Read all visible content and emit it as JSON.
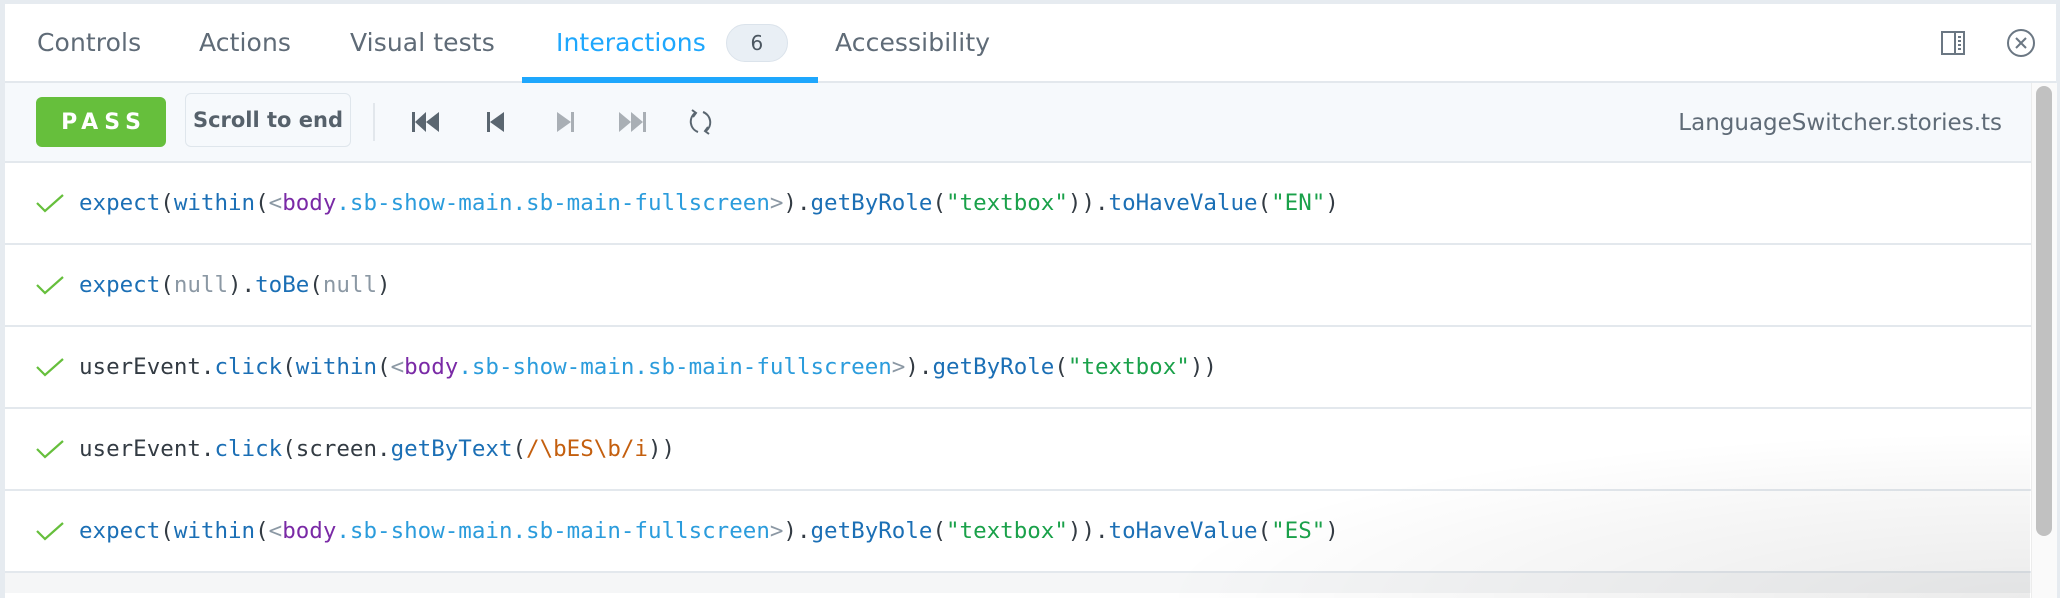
{
  "tabs": [
    {
      "label": "Controls",
      "active": false
    },
    {
      "label": "Actions",
      "active": false
    },
    {
      "label": "Visual tests",
      "active": false
    },
    {
      "label": "Interactions",
      "active": true,
      "badge": "6"
    },
    {
      "label": "Accessibility",
      "active": false
    }
  ],
  "tab_actions": {
    "toggle_panel_icon": "sidebar-right-icon",
    "close_icon": "close-circle-icon"
  },
  "toolbar": {
    "status_label": "PASS",
    "scroll_to_end_label": "Scroll to end",
    "nav": [
      "jump-to-start-icon",
      "step-back-icon",
      "step-forward-icon",
      "jump-to-end-icon",
      "rerun-icon"
    ],
    "story_file": "LanguageSwitcher.stories.ts"
  },
  "colors": {
    "accent": "#1ea7fd",
    "pass": "#66bf3c",
    "check": "#66bf3c",
    "function": "#1b6fb5",
    "string": "#1aa14a",
    "element_tag": "#7a2aa6",
    "element_class": "#2b9cdc",
    "regex": "#c45f0e",
    "null": "#8b98a4"
  },
  "interactions": [
    {
      "status": "pass",
      "tokens": [
        {
          "t": "expect",
          "k": "fn"
        },
        {
          "t": "(",
          "k": "punct"
        },
        {
          "t": "within",
          "k": "fn"
        },
        {
          "t": "(",
          "k": "punct"
        },
        {
          "t": "<",
          "k": "el-bracket"
        },
        {
          "t": "body",
          "k": "el-tag"
        },
        {
          "t": ".sb-show-main.sb-main-fullscreen",
          "k": "el-cls"
        },
        {
          "t": ">",
          "k": "el-bracket"
        },
        {
          "t": ").",
          "k": "punct"
        },
        {
          "t": "getByRole",
          "k": "fn"
        },
        {
          "t": "(",
          "k": "punct"
        },
        {
          "t": "\"textbox\"",
          "k": "str"
        },
        {
          "t": ")).",
          "k": "punct"
        },
        {
          "t": "toHaveValue",
          "k": "fn"
        },
        {
          "t": "(",
          "k": "punct"
        },
        {
          "t": "\"EN\"",
          "k": "str"
        },
        {
          "t": ")",
          "k": "punct"
        }
      ]
    },
    {
      "status": "pass",
      "tokens": [
        {
          "t": "expect",
          "k": "fn"
        },
        {
          "t": "(",
          "k": "punct"
        },
        {
          "t": "null",
          "k": "null"
        },
        {
          "t": ").",
          "k": "punct"
        },
        {
          "t": "toBe",
          "k": "fn"
        },
        {
          "t": "(",
          "k": "punct"
        },
        {
          "t": "null",
          "k": "null"
        },
        {
          "t": ")",
          "k": "punct"
        }
      ]
    },
    {
      "status": "pass",
      "tokens": [
        {
          "t": "userEvent",
          "k": "ident"
        },
        {
          "t": ".",
          "k": "punct"
        },
        {
          "t": "click",
          "k": "fn"
        },
        {
          "t": "(",
          "k": "punct"
        },
        {
          "t": "within",
          "k": "fn"
        },
        {
          "t": "(",
          "k": "punct"
        },
        {
          "t": "<",
          "k": "el-bracket"
        },
        {
          "t": "body",
          "k": "el-tag"
        },
        {
          "t": ".sb-show-main.sb-main-fullscreen",
          "k": "el-cls"
        },
        {
          "t": ">",
          "k": "el-bracket"
        },
        {
          "t": ").",
          "k": "punct"
        },
        {
          "t": "getByRole",
          "k": "fn"
        },
        {
          "t": "(",
          "k": "punct"
        },
        {
          "t": "\"textbox\"",
          "k": "str"
        },
        {
          "t": "))",
          "k": "punct"
        }
      ]
    },
    {
      "status": "pass",
      "tokens": [
        {
          "t": "userEvent",
          "k": "ident"
        },
        {
          "t": ".",
          "k": "punct"
        },
        {
          "t": "click",
          "k": "fn"
        },
        {
          "t": "(",
          "k": "punct"
        },
        {
          "t": "screen",
          "k": "ident"
        },
        {
          "t": ".",
          "k": "punct"
        },
        {
          "t": "getByText",
          "k": "fn"
        },
        {
          "t": "(",
          "k": "punct"
        },
        {
          "t": "/\\bES\\b/i",
          "k": "regex"
        },
        {
          "t": "))",
          "k": "punct"
        }
      ]
    },
    {
      "status": "pass",
      "tokens": [
        {
          "t": "expect",
          "k": "fn"
        },
        {
          "t": "(",
          "k": "punct"
        },
        {
          "t": "within",
          "k": "fn"
        },
        {
          "t": "(",
          "k": "punct"
        },
        {
          "t": "<",
          "k": "el-bracket"
        },
        {
          "t": "body",
          "k": "el-tag"
        },
        {
          "t": ".sb-show-main.sb-main-fullscreen",
          "k": "el-cls"
        },
        {
          "t": ">",
          "k": "el-bracket"
        },
        {
          "t": ").",
          "k": "punct"
        },
        {
          "t": "getByRole",
          "k": "fn"
        },
        {
          "t": "(",
          "k": "punct"
        },
        {
          "t": "\"textbox\"",
          "k": "str"
        },
        {
          "t": ")).",
          "k": "punct"
        },
        {
          "t": "toHaveValue",
          "k": "fn"
        },
        {
          "t": "(",
          "k": "punct"
        },
        {
          "t": "\"ES\"",
          "k": "str"
        },
        {
          "t": ")",
          "k": "punct"
        }
      ]
    }
  ]
}
